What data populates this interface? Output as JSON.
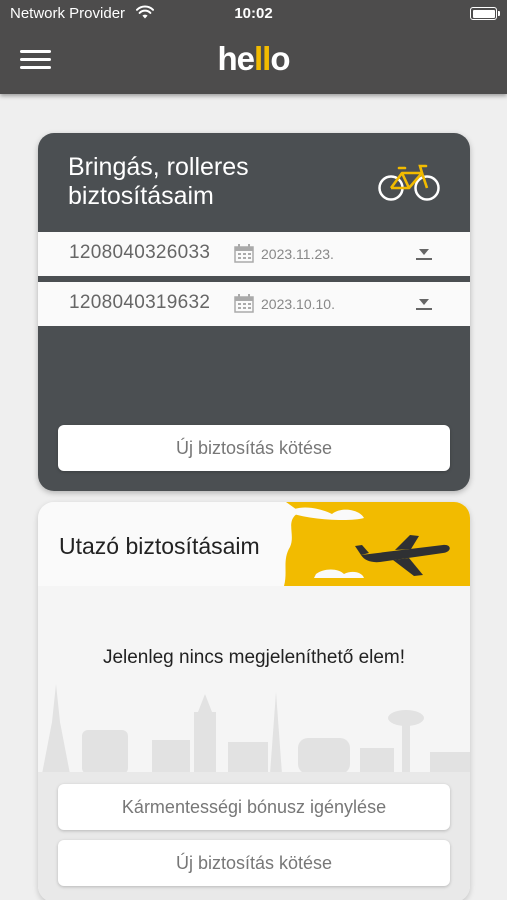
{
  "status_bar": {
    "provider": "Network Provider",
    "time": "10:02"
  },
  "header": {
    "logo": {
      "part1": "he",
      "part2": "ll",
      "part3": "o"
    }
  },
  "bike_section": {
    "title_line1": "Bringás, rolleres",
    "title_line2": "biztosításaim",
    "policies": [
      {
        "number": "1208040326033",
        "date": "2023.11.23."
      },
      {
        "number": "1208040319632",
        "date": "2023.10.10."
      }
    ],
    "new_button": "Új biztosítás kötése"
  },
  "travel_section": {
    "title": "Utazó biztosításaim",
    "empty_message": "Jelenleg nincs megjeleníthető elem!",
    "bonus_button": "Kármentességi bónusz igénylése",
    "new_button": "Új biztosítás kötése"
  },
  "colors": {
    "header_bg": "#4d4c4c",
    "card_dark": "#4b4f52",
    "accent": "#f2bb00"
  }
}
